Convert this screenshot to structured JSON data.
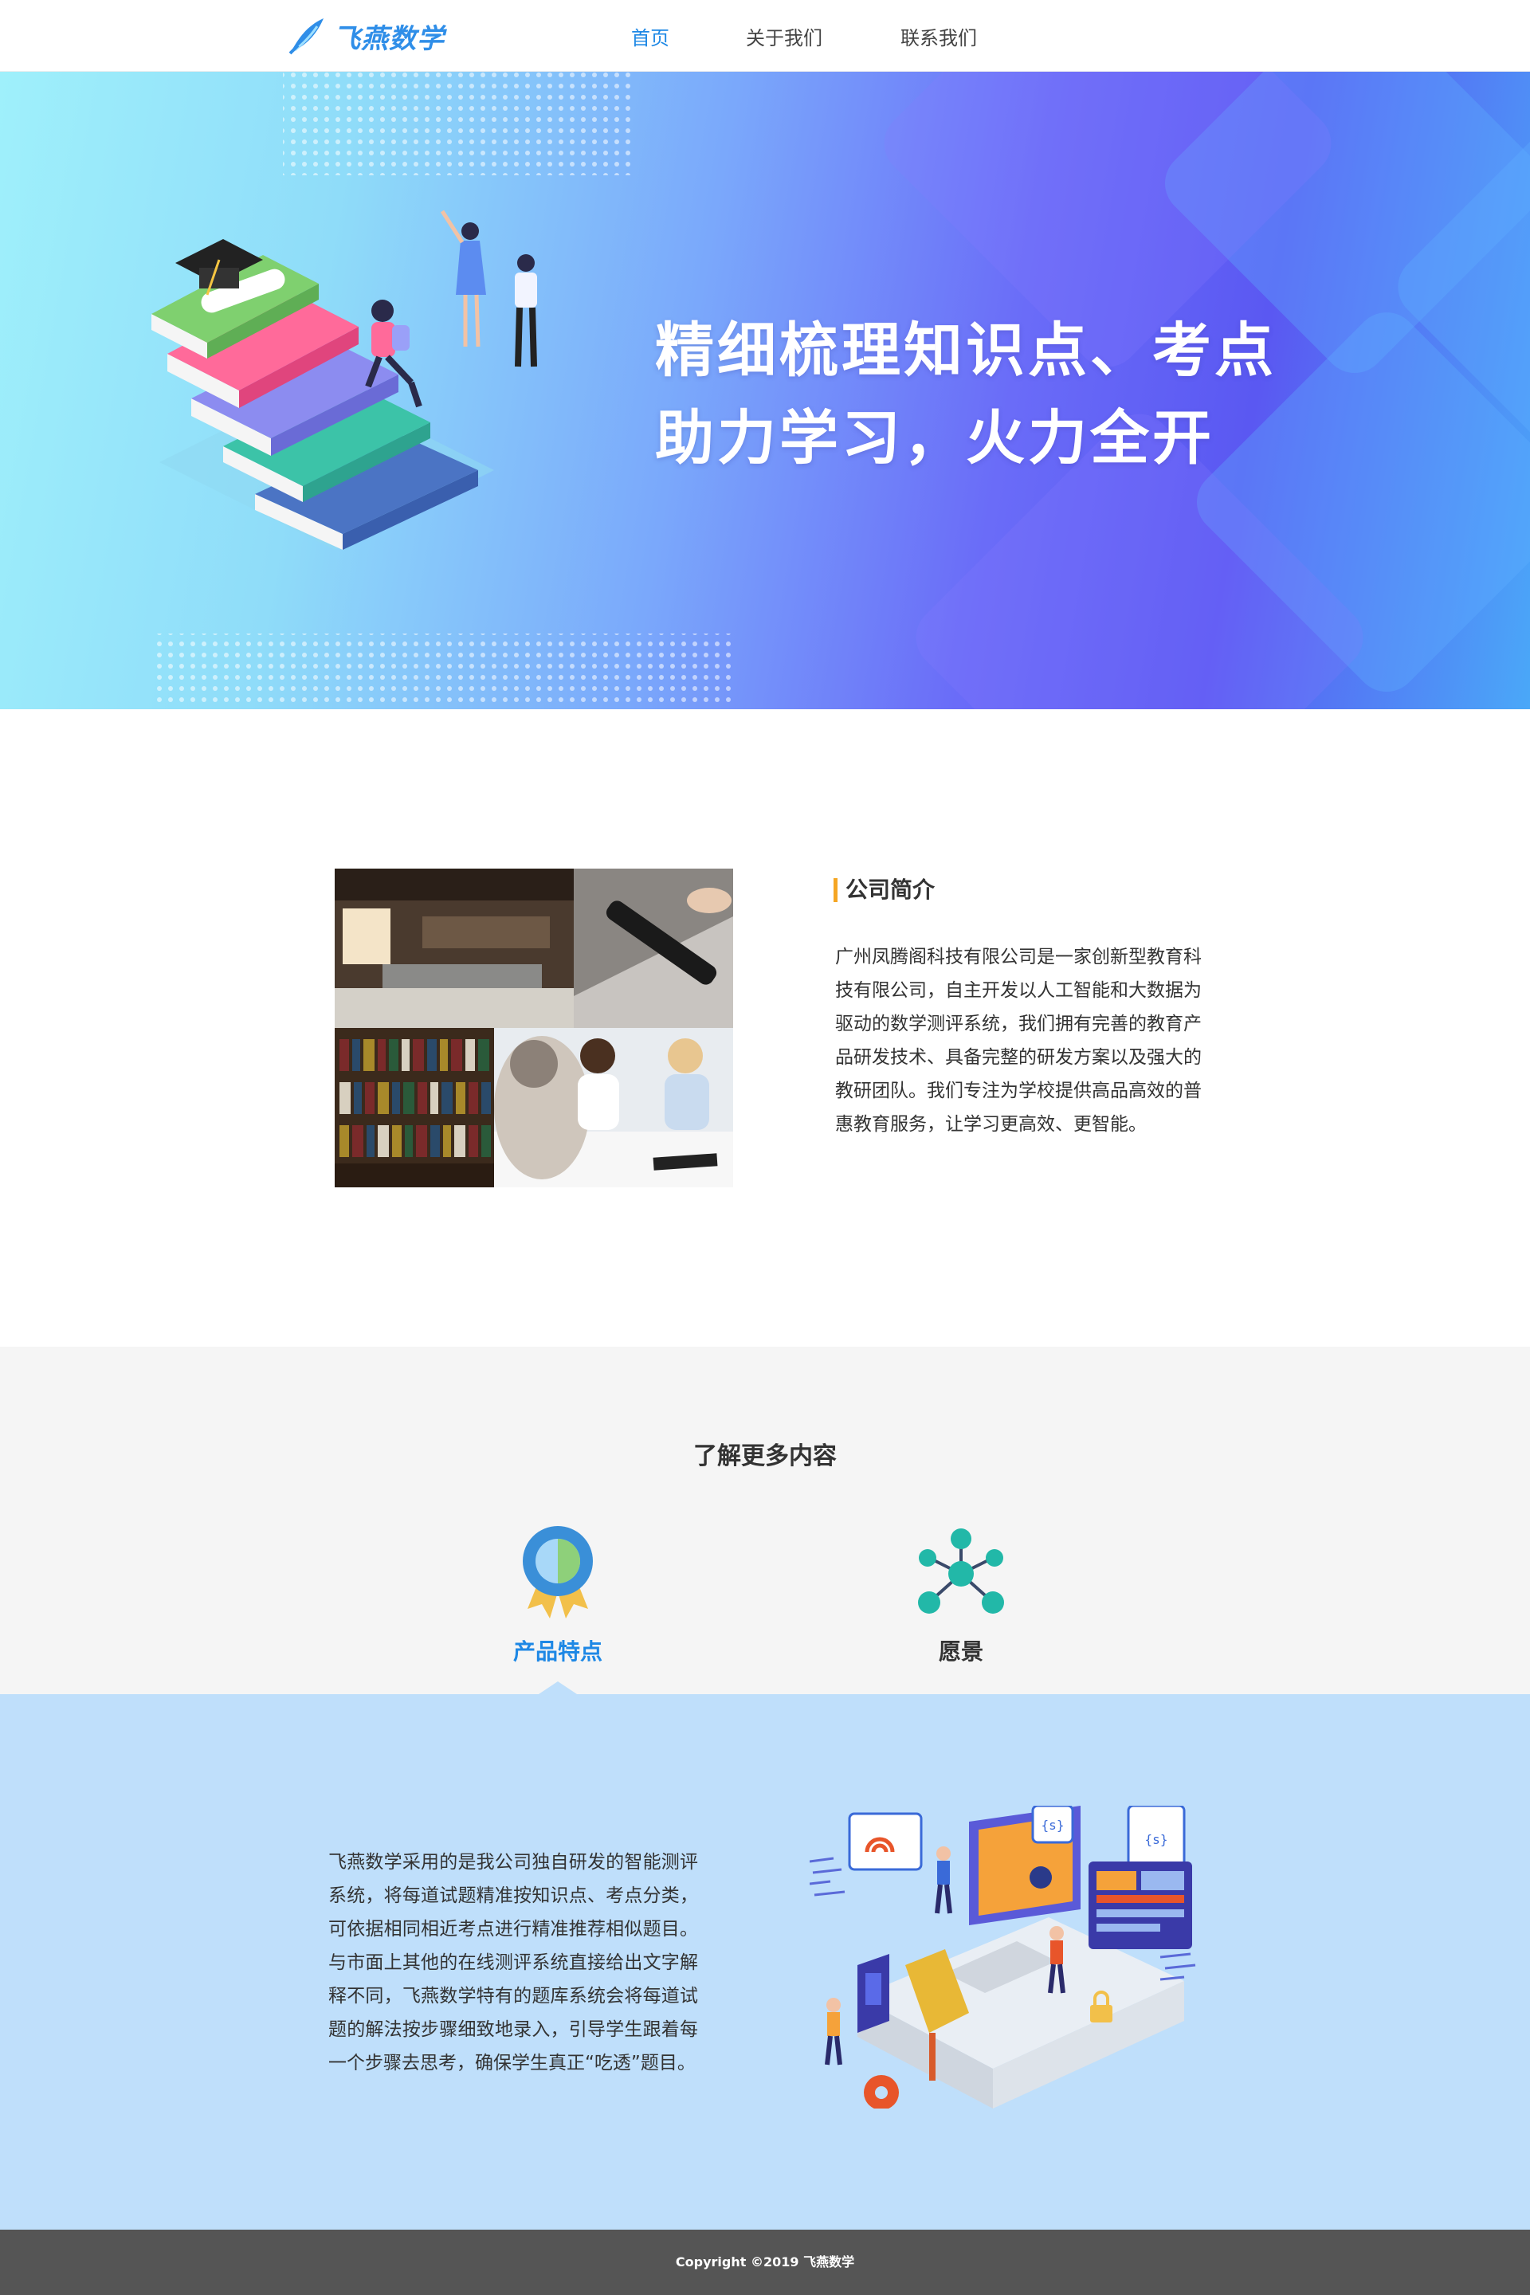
{
  "nav": {
    "logo_text": "飞燕数学",
    "links": [
      {
        "label": "首页",
        "active": true
      },
      {
        "label": "关于我们",
        "active": false
      },
      {
        "label": "联系我们",
        "active": false
      }
    ],
    "active_color": "#1e88e5"
  },
  "hero": {
    "line1": "精细梳理知识点、考点",
    "line2": "助力学习，火力全开"
  },
  "about": {
    "heading": "公司简介",
    "text": "广州凤腾阁科技有限公司是一家创新型教育科技有限公司，自主开发以人工智能和大数据为驱动的数学测评系统，我们拥有完善的教育产品研发技术、具备完整的研发方案以及强大的教研团队。我们专注为学校提供高品高效的普惠教育服务，让学习更高效、更智能。"
  },
  "more": {
    "title": "了解更多内容",
    "tabs": [
      {
        "label": "产品特点",
        "icon": "award-medal-icon",
        "active": true
      },
      {
        "label": "愿景",
        "icon": "network-nodes-icon",
        "active": false
      }
    ]
  },
  "feature": {
    "text": "飞燕数学采用的是我公司独自研发的智能测评系统，将每道试题精准按知识点、考点分类，可依据相同相近考点进行精准推荐相似题目。与市面上其他的在线测评系统直接给出文字解释不同，飞燕数学特有的题库系统会将每道试题的解法按步骤细致地录入，引导学生跟着每一个步骤去思考，确保学生真正“吃透”题目。"
  },
  "footer": {
    "copyright": "Copyright ©2019 飞燕数学"
  },
  "colors": {
    "brand_blue": "#1e88e5",
    "accent_orange": "#f5a623",
    "feature_bg": "#bfdffb",
    "footer_bg": "#555555"
  }
}
